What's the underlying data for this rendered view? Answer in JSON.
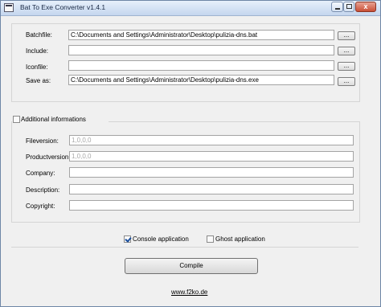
{
  "window": {
    "title": "Bat To Exe Converter v1.4.1",
    "close_glyph": "x"
  },
  "files": {
    "batchfile": {
      "label": "Batchfile:",
      "value": "C:\\Documents and Settings\\Administrator\\Desktop\\pulizia-dns.bat"
    },
    "include": {
      "label": "Include:",
      "value": ""
    },
    "iconfile": {
      "label": "Iconfile:",
      "value": ""
    },
    "saveas": {
      "label": "Save as:",
      "value": "C:\\Documents and Settings\\Administrator\\Desktop\\pulizia-dns.exe"
    },
    "browse_label": "..."
  },
  "info": {
    "checkbox_label": "Additional informations",
    "checked": false,
    "fileversion": {
      "label": "Fileversion:",
      "value": "1,0,0,0"
    },
    "productversion": {
      "label": "Productversion:",
      "value": "1,0,0,0"
    },
    "company": {
      "label": "Company:",
      "value": ""
    },
    "description": {
      "label": "Description:",
      "value": ""
    },
    "copyright": {
      "label": "Copyright:",
      "value": ""
    }
  },
  "options": {
    "console": {
      "label": "Console application",
      "checked": true
    },
    "ghost": {
      "label": "Ghost application",
      "checked": false
    }
  },
  "compile_label": "Compile",
  "link_text": "www.f2ko.de"
}
